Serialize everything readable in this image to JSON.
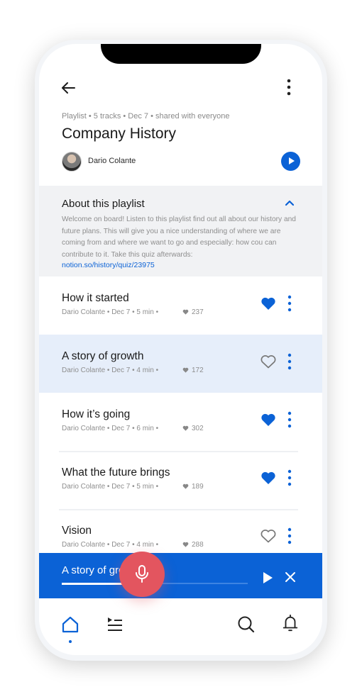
{
  "header": {
    "back_icon": "arrow-left-icon",
    "more_icon": "more-vertical-icon",
    "meta": "Playlist • 5 tracks • Dec 7 • shared with everyone",
    "title": "Company History",
    "author": "Dario Colante",
    "play_icon": "play-icon"
  },
  "about": {
    "heading": "About this playlist",
    "toggle_icon": "chevron-up-icon",
    "text": "Welcome on board! Listen to this playlist find out all about our history and future plans. This will give you a nice understanding of where we are coming from and where we want to go and especially: how cou can contribute to it. Take this quiz afterwards:",
    "link": "notion.so/history/quiz/23975"
  },
  "tracks": [
    {
      "title": "How it started",
      "meta": "Dario Colante • Dec 7 • 5 min •",
      "likes": "237",
      "liked": true,
      "highlighted": false
    },
    {
      "title": "A story of growth",
      "meta": "Dario Colante • Dec 7 • 4 min •",
      "likes": "172",
      "liked": false,
      "highlighted": true
    },
    {
      "title": "How it’s going",
      "meta": "Dario Colante • Dec 7 • 6 min •",
      "likes": "302",
      "liked": true,
      "highlighted": false
    },
    {
      "title": "What the future brings",
      "meta": "Dario Colante • Dec 7 • 5 min •",
      "likes": "189",
      "liked": true,
      "highlighted": false
    },
    {
      "title": "Vision",
      "meta": "Dario Colante • Dec 7 • 4 min •",
      "likes": "288",
      "liked": false,
      "highlighted": false
    }
  ],
  "mini_player": {
    "title": "A story of growth",
    "progress": 0.53,
    "play_icon": "play-icon",
    "close_icon": "close-icon"
  },
  "bottom_nav": {
    "items": [
      "home-icon",
      "playlist-icon",
      "microphone-icon",
      "search-icon",
      "bell-icon"
    ],
    "active": "home"
  },
  "colors": {
    "accent": "#0b62d6",
    "highlight_row": "#e6eefa",
    "mic": "#e3555f",
    "about_bg": "#f1f2f4"
  }
}
